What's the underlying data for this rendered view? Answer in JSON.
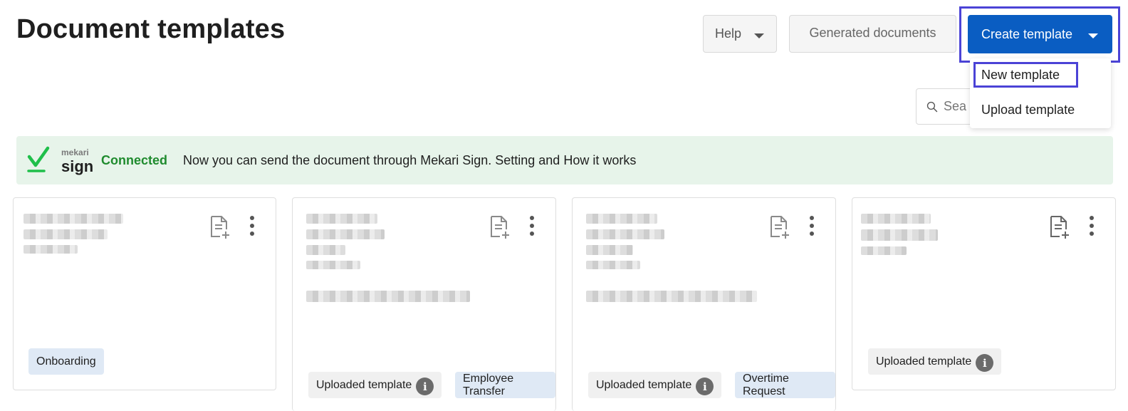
{
  "header": {
    "title": "Document templates",
    "help_label": "Help",
    "generated_label": "Generated documents",
    "create_label": "Create template"
  },
  "dropdown": {
    "items": [
      {
        "label": "New template"
      },
      {
        "label": "Upload template"
      }
    ]
  },
  "search": {
    "placeholder": "Sea"
  },
  "banner": {
    "logo_small": "mekari",
    "logo_big": "sign",
    "status": "Connected",
    "text": "Now you can send the document through Mekari Sign. Setting and How it works"
  },
  "cards": [
    {
      "tags": [
        {
          "label": "Onboarding",
          "style": "blue"
        }
      ]
    },
    {
      "tags": [
        {
          "label": "Uploaded template",
          "style": "gray",
          "info": true
        },
        {
          "label": "Employee Transfer",
          "style": "blue"
        }
      ]
    },
    {
      "tags": [
        {
          "label": "Uploaded template",
          "style": "gray",
          "info": true
        },
        {
          "label": "Overtime Request",
          "style": "blue"
        }
      ]
    },
    {
      "tags": [
        {
          "label": "Uploaded template",
          "style": "gray",
          "info": true
        }
      ]
    }
  ],
  "icons": {
    "info_glyph": "i"
  },
  "colors": {
    "primary": "#0a5dc2",
    "highlight": "#4b43d6",
    "banner_bg": "#e7f4ea",
    "connected": "#1f8b2e",
    "tag_blue": "#dfe9f5",
    "tag_gray": "#f0f0f0"
  }
}
